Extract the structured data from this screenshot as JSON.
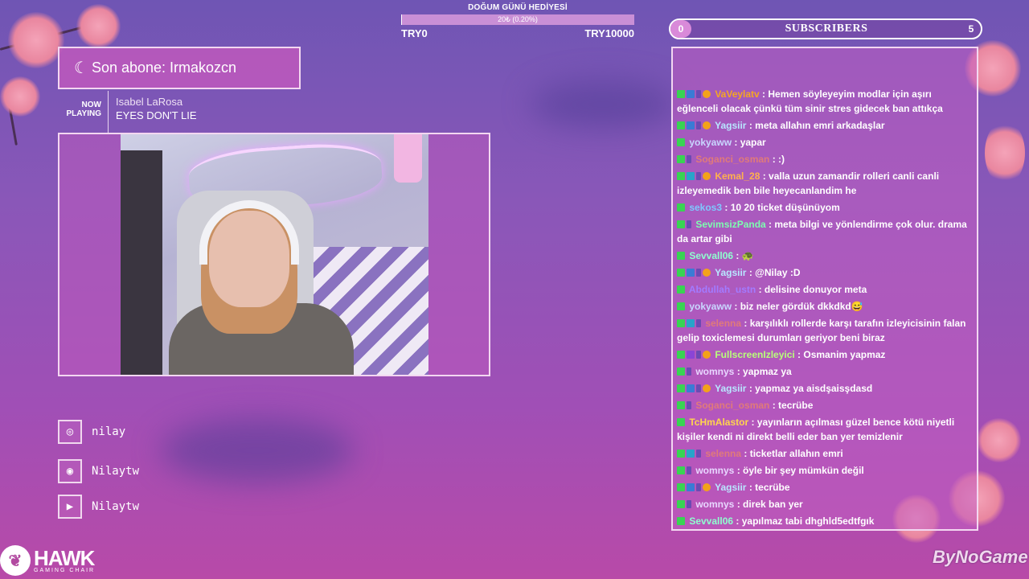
{
  "donation": {
    "title": "DOĞUM GÜNÜ HEDİYESİ",
    "progress_label": "20₺ (0.20%)",
    "progress_fraction": 0.002,
    "start": "TRY0",
    "goal": "TRY10000"
  },
  "subscribers": {
    "label": "SUBSCRIBERS",
    "current": "0",
    "goal": "5"
  },
  "last_sub": {
    "text": "Son abone: Irmakozcn"
  },
  "now_playing": {
    "label_line1": "NOW",
    "label_line2": "PLAYING",
    "artist": "Isabel LaRosa",
    "song": "EYES DON'T LIE"
  },
  "socials": [
    {
      "icon": "discord-icon",
      "glyph": "◎",
      "handle": "nilay"
    },
    {
      "icon": "instagram-icon",
      "glyph": "◉",
      "handle": "Nilaytw"
    },
    {
      "icon": "youtube-icon",
      "glyph": "▶",
      "handle": "Nilaytw"
    }
  ],
  "brands": {
    "left": "HAWK",
    "left_sub": "GAMING CHAIR",
    "right": "ByNoGame"
  },
  "chat": [
    {
      "user": "VaVeylatv",
      "color": "#f5a623",
      "badges": [
        "k",
        "b",
        "s",
        "g"
      ],
      "text": ": Hemen söyleyeyim modlar için aşırı eğlenceli olacak çünkü tüm sinir stres gidecek ban attıkça"
    },
    {
      "user": "Yagsiir",
      "color": "#b8e6ff",
      "badges": [
        "k",
        "b",
        "s",
        "g"
      ],
      "text": ": meta allahın emri arkadaşlar"
    },
    {
      "user": "yokyaww",
      "color": "#c9d6ff",
      "badges": [
        "k"
      ],
      "text": ": yapar"
    },
    {
      "user": "Soganci_osman",
      "color": "#e07a7a",
      "badges": [
        "k",
        "s"
      ],
      "text": ": :)"
    },
    {
      "user": "Kemal_28",
      "color": "#ffb14d",
      "badges": [
        "k",
        "c",
        "s",
        "g"
      ],
      "text": ": valla uzun zamandir rolleri canli canli izleyemedik ben bile heyecanlandim he"
    },
    {
      "user": "sekos3",
      "color": "#7ec8ff",
      "badges": [
        "k"
      ],
      "text": ": 10 20 ticket düşünüyom"
    },
    {
      "user": "SevimsizPanda",
      "color": "#7dffb0",
      "badges": [
        "k",
        "s"
      ],
      "text": ": meta bilgi ve yönlendirme çok olur. drama da artar gibi"
    },
    {
      "user": "Sevvall06",
      "color": "#8fffcf",
      "badges": [
        "k"
      ],
      "text": ": 🐢"
    },
    {
      "user": "Yagsiir",
      "color": "#b8e6ff",
      "badges": [
        "k",
        "b",
        "s",
        "g"
      ],
      "text": ": @Nilay :D"
    },
    {
      "user": "Abdullah_ustn",
      "color": "#a27bff",
      "badges": [
        "k"
      ],
      "text": ": delisine donuyor meta"
    },
    {
      "user": "yokyaww",
      "color": "#c9d6ff",
      "badges": [
        "k"
      ],
      "text": ": biz neler gördük dkkdkd😅"
    },
    {
      "user": "selenna",
      "color": "#e07a7a",
      "badges": [
        "k",
        "c",
        "s"
      ],
      "text": ": karşılıklı rollerde karşı tarafın izleyicisinin falan gelip toxiclemesi durumları geriyor beni biraz"
    },
    {
      "user": "FullscreenIzleyici",
      "color": "#b8ff7a",
      "badges": [
        "k",
        "p",
        "s",
        "g"
      ],
      "text": ": Osmanim yapmaz"
    },
    {
      "user": "womnys",
      "color": "#e8d6ff",
      "badges": [
        "k",
        "s"
      ],
      "text": ": yapmaz ya"
    },
    {
      "user": "Yagsiir",
      "color": "#b8e6ff",
      "badges": [
        "k",
        "b",
        "s",
        "g"
      ],
      "text": ": yapmaz ya aisdşaisşdasd"
    },
    {
      "user": "Soganci_osman",
      "color": "#e07a7a",
      "badges": [
        "k",
        "s"
      ],
      "text": ": tecrübe"
    },
    {
      "user": "TcHmAlastor",
      "color": "#ffd54d",
      "badges": [
        "k"
      ],
      "text": ": yayınların açılması güzel bence kötü niyetli kişiler kendi ni direkt belli eder ban yer temizlenir"
    },
    {
      "user": "selenna",
      "color": "#e07a7a",
      "badges": [
        "k",
        "c",
        "s"
      ],
      "text": ": ticketlar allahın emri"
    },
    {
      "user": "womnys",
      "color": "#e8d6ff",
      "badges": [
        "k",
        "s"
      ],
      "text": ": öyle bir şey mümkün değil"
    },
    {
      "user": "Yagsiir",
      "color": "#b8e6ff",
      "badges": [
        "k",
        "b",
        "s",
        "g"
      ],
      "text": ": tecrübe"
    },
    {
      "user": "womnys",
      "color": "#e8d6ff",
      "badges": [
        "k",
        "s"
      ],
      "text": ": direk ban yer"
    },
    {
      "user": "Sevvall06",
      "color": "#8fffcf",
      "badges": [
        "k"
      ],
      "text": ": yapılmaz tabi dhghld5edtfgık"
    }
  ]
}
